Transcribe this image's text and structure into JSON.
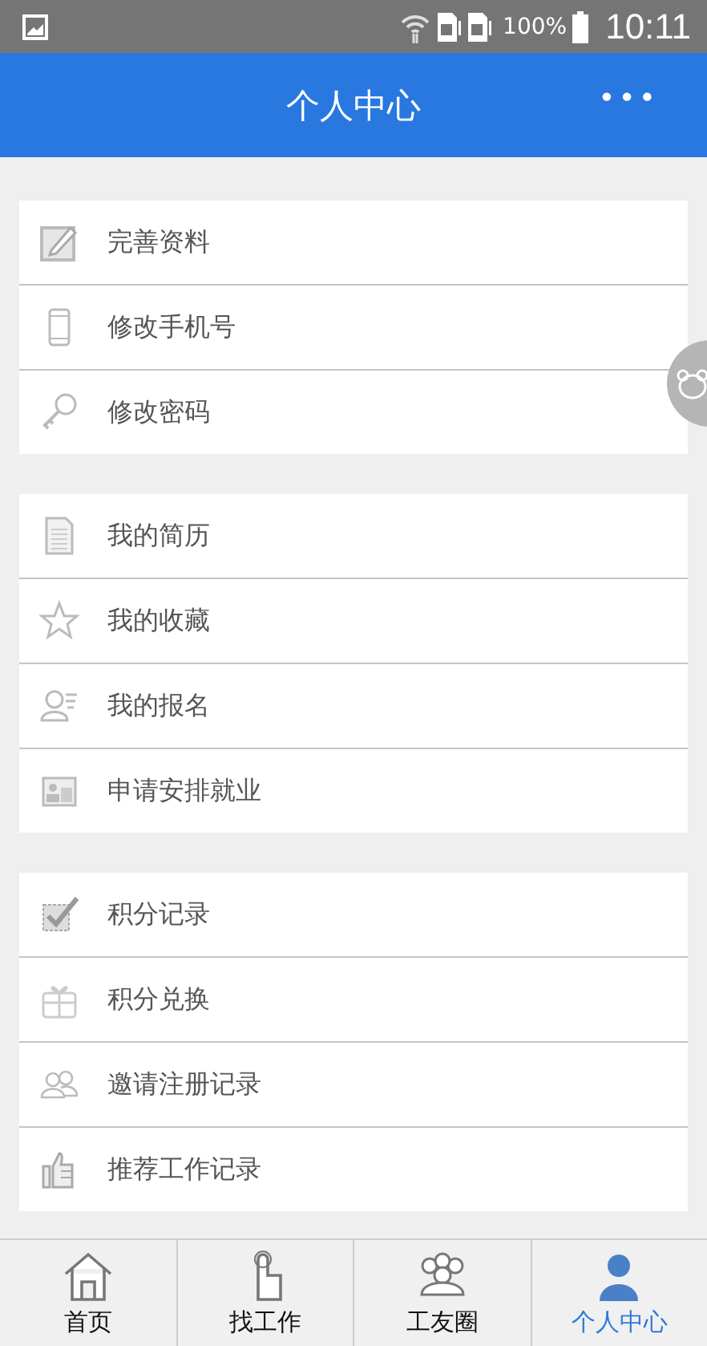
{
  "status_bar": {
    "battery": "100%",
    "time": "10:11"
  },
  "header": {
    "title": "个人中心",
    "menu": "•••"
  },
  "groups": [
    {
      "items": [
        {
          "label": "完善资料"
        },
        {
          "label": "修改手机号"
        },
        {
          "label": "修改密码"
        }
      ]
    },
    {
      "items": [
        {
          "label": "我的简历"
        },
        {
          "label": "我的收藏"
        },
        {
          "label": "我的报名"
        },
        {
          "label": "申请安排就业"
        }
      ]
    },
    {
      "items": [
        {
          "label": "积分记录"
        },
        {
          "label": "积分兑换"
        },
        {
          "label": "邀请注册记录"
        },
        {
          "label": "推荐工作记录"
        }
      ]
    }
  ],
  "tabs": [
    {
      "label": "首页",
      "selected": false
    },
    {
      "label": "找工作",
      "selected": false
    },
    {
      "label": "工友圈",
      "selected": false
    },
    {
      "label": "个人中心",
      "selected": true
    }
  ]
}
